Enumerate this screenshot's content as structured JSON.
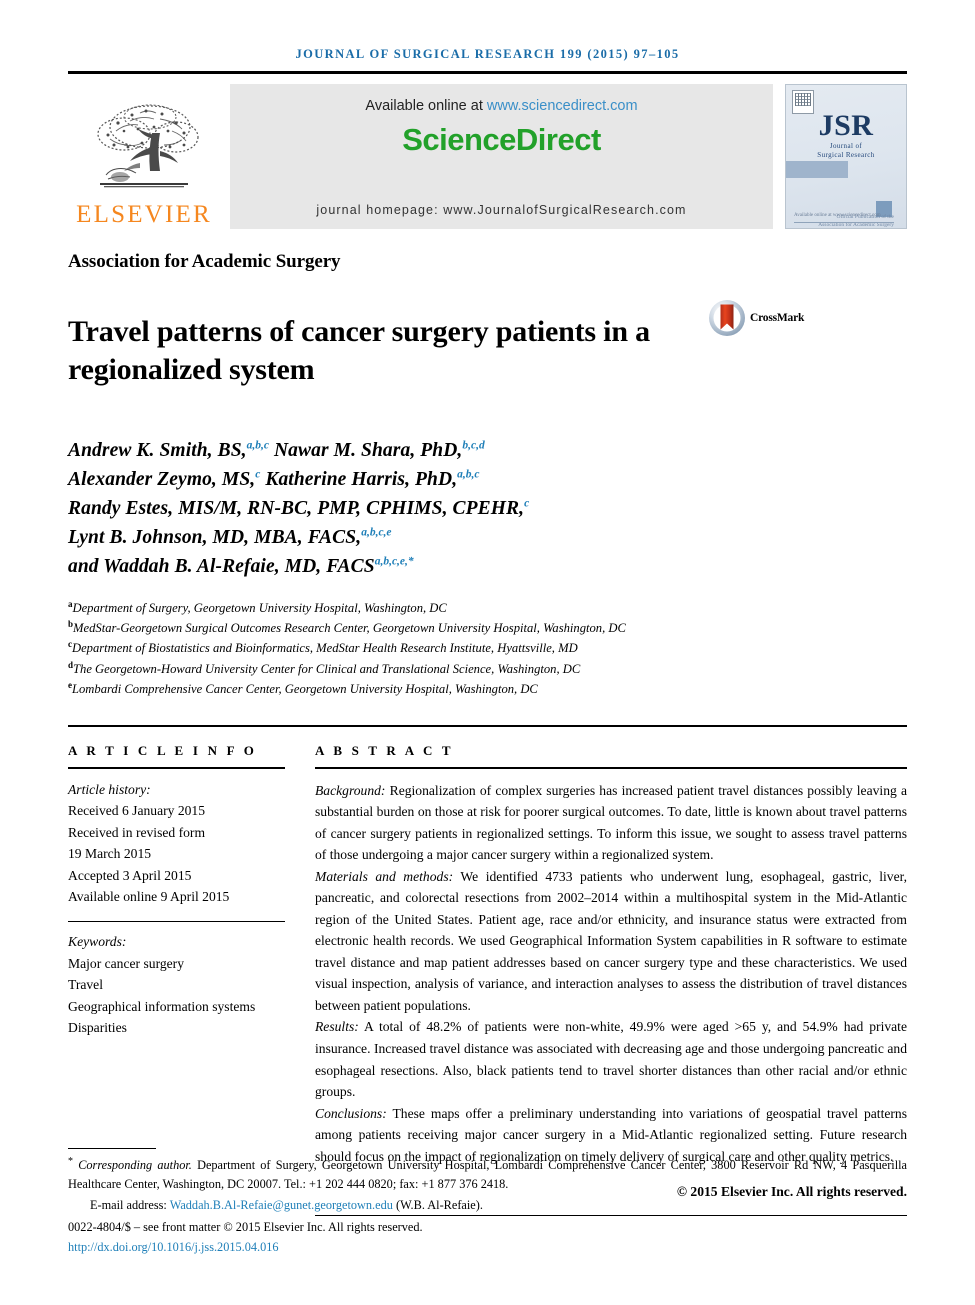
{
  "running_head": "JOURNAL OF SURGICAL RESEARCH 199 (2015) 97–105",
  "masthead": {
    "publisher_name": "ELSEVIER",
    "available_prefix": "Available online at",
    "sciencedirect_url": "www.sciencedirect.com",
    "sciencedirect_logo": "ScienceDirect",
    "journal_homepage": "journal homepage: www.JournalofSurgicalResearch.com",
    "cover": {
      "abbrev": "JSR",
      "sub1": "Journal of",
      "sub2": "Surgical Research",
      "mid_note": "Official Publication of the Association for Academic Surgery",
      "foot_note": "Available online at www.sciencedirect.com"
    }
  },
  "society": "Association for Academic Surgery",
  "title": "Travel patterns of cancer surgery patients in a regionalized system",
  "crossmark_label": "CrossMark",
  "authors": [
    {
      "name": "Andrew K. Smith, BS,",
      "sup": "a,b,c"
    },
    {
      "name": "Nawar M. Shara, PhD,",
      "sup": "b,c,d"
    },
    {
      "name": "Alexander Zeymo, MS,",
      "sup": "c"
    },
    {
      "name": "Katherine Harris, PhD,",
      "sup": "a,b,c"
    },
    {
      "name": "Randy Estes, MIS/M, RN-BC, PMP, CPHIMS, CPEHR,",
      "sup": "c"
    },
    {
      "name": "Lynt B. Johnson, MD, MBA, FACS,",
      "sup": "a,b,c,e"
    },
    {
      "name": "and Waddah B. Al-Refaie, MD, FACS",
      "sup": "a,b,c,e,*"
    }
  ],
  "affiliations": [
    {
      "mark": "a",
      "text": "Department of Surgery, Georgetown University Hospital, Washington, DC"
    },
    {
      "mark": "b",
      "text": "MedStar-Georgetown Surgical Outcomes Research Center, Georgetown University Hospital, Washington, DC"
    },
    {
      "mark": "c",
      "text": "Department of Biostatistics and Bioinformatics, MedStar Health Research Institute, Hyattsville, MD"
    },
    {
      "mark": "d",
      "text": "The Georgetown-Howard University Center for Clinical and Translational Science, Washington, DC"
    },
    {
      "mark": "e",
      "text": "Lombardi Comprehensive Cancer Center, Georgetown University Hospital, Washington, DC"
    }
  ],
  "article_info": {
    "heading": "A R T I C L E  I N F O",
    "history_label": "Article history:",
    "history": [
      "Received 6 January 2015",
      "Received in revised form",
      "19 March 2015",
      "Accepted 3 April 2015",
      "Available online 9 April 2015"
    ],
    "keywords_label": "Keywords:",
    "keywords": [
      "Major cancer surgery",
      "Travel",
      "Geographical information systems",
      "Disparities"
    ]
  },
  "abstract": {
    "heading": "A B S T R A C T",
    "sections": [
      {
        "label": "Background:",
        "text": " Regionalization of complex surgeries has increased patient travel distances possibly leaving a substantial burden on those at risk for poorer surgical outcomes. To date, little is known about travel patterns of cancer surgery patients in regionalized settings. To inform this issue, we sought to assess travel patterns of those undergoing a major cancer surgery within a regionalized system."
      },
      {
        "label": "Materials and methods:",
        "text": " We identified 4733 patients who underwent lung, esophageal, gastric, liver, pancreatic, and colorectal resections from 2002–2014 within a multihospital system in the Mid-Atlantic region of the United States. Patient age, race and/or ethnicity, and insurance status were extracted from electronic health records. We used Geographical Information System capabilities in R software to estimate travel distance and map patient addresses based on cancer surgery type and these characteristics. We used visual inspection, analysis of variance, and interaction analyses to assess the distribution of travel distances between patient populations."
      },
      {
        "label": "Results:",
        "text": " A total of 48.2% of patients were non-white, 49.9% were aged >65 y, and 54.9% had private insurance. Increased travel distance was associated with decreasing age and those undergoing pancreatic and esophageal resections. Also, black patients tend to travel shorter distances than other racial and/or ethnic groups."
      },
      {
        "label": "Conclusions:",
        "text": " These maps offer a preliminary understanding into variations of geospatial travel patterns among patients receiving major cancer surgery in a Mid-Atlantic regionalized setting. Future research should focus on the impact of regionalization on timely delivery of surgical care and other quality metrics."
      }
    ],
    "copyright": "© 2015 Elsevier Inc. All rights reserved."
  },
  "footnotes": {
    "corresponding_label": "Corresponding author.",
    "corresponding_text": " Department of Surgery, Georgetown University Hospital, Lombardi Comprehensive Cancer Center, 3800 Reservoir Rd NW, 4 Pasquerilla Healthcare Center, Washington, DC 20007. Tel.: +1 202 444 0820; fax: +1 877 376 2418.",
    "email_label": "E-mail address:",
    "email": "Waddah.B.Al-Refaie@gunet.georgetown.edu",
    "email_suffix": "(W.B. Al-Refaie).",
    "front_matter": "0022-4804/$ – see front matter © 2015 Elsevier Inc. All rights reserved.",
    "doi": "http://dx.doi.org/10.1016/j.jss.2015.04.016"
  },
  "colors": {
    "link": "#1f7fb8",
    "elsevier_orange": "#f5871f",
    "sciencedirect_green": "#22a12a",
    "running_head_blue": "#1a6ca8"
  }
}
